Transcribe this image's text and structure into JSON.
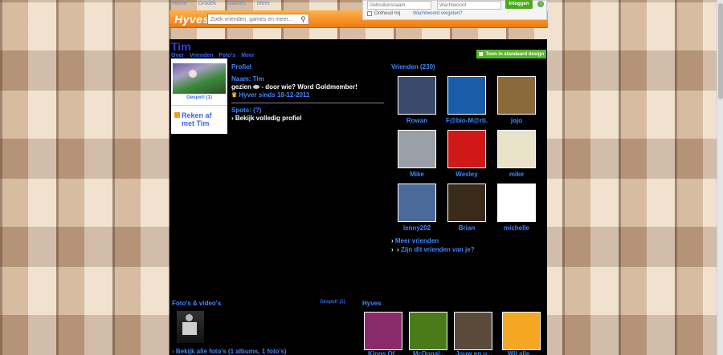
{
  "topnav": [
    "Home",
    "Ontdek",
    "Games",
    "Meer"
  ],
  "header": {
    "logo": "Hyves",
    "search_placeholder": "Zoek vrienden, games en meer..."
  },
  "login": {
    "username_placeholder": "Gebruikersnaam",
    "password_placeholder": "Wachtwoord",
    "button": "Inloggen",
    "remember": "Onthoud mij",
    "forgot": "Wachtwoord vergeten?"
  },
  "profile": {
    "name": "Tim",
    "subnav": [
      "Over",
      "Vrienden",
      "Foto's",
      "Meer"
    ],
    "standard_design_button": "Toon in standaard design",
    "gespot": "Gespot! (1)",
    "reken_af": [
      "Reken af",
      "met Tim"
    ],
    "section_title": "Profiel",
    "name_line": "Naam: Tim",
    "gezien_prefix": "gezien",
    "gezien_suffix": "- door wie? Word Goldmember!",
    "hyver_sinds": "Hyver sinds 18-12-2011",
    "spots": "Spots: (?)",
    "volledig_profiel": "Bekijk volledig profiel"
  },
  "friends": {
    "title": "Vrienden (230)",
    "items": [
      {
        "name": "Rowan",
        "color": "#3b4a6a"
      },
      {
        "name": "F@bio-M@rti...",
        "color": "#1a5ca8"
      },
      {
        "name": "jojo",
        "color": "#8a6a3a"
      },
      {
        "name": "Mike",
        "color": "#9aa0a8"
      },
      {
        "name": "Wesley",
        "color": "#d01818"
      },
      {
        "name": "mike",
        "color": "#e8e2c8"
      },
      {
        "name": "lenny202",
        "color": "#4a6a9a"
      },
      {
        "name": "Brian",
        "color": "#3a2a1a"
      },
      {
        "name": "michelle",
        "color": "#ffffff"
      }
    ],
    "meer": "Meer vrienden",
    "zijn_dit": "Zijn dit vrienden van je?"
  },
  "fotos": {
    "title": "Foto's & video's",
    "gespot": "Gespot! (1)",
    "all": "Bekijk alle foto's (1 albums, 1 foto's)"
  },
  "hyves": {
    "title": "Hyves",
    "items": [
      {
        "name": "Kings Of...",
        "color": "#8a2a6a"
      },
      {
        "name": "McDonal...",
        "color": "#4a7a1a"
      },
      {
        "name": "Jouw en u...",
        "color": "#5a4a3a"
      },
      {
        "name": "Wil alle ...",
        "color": "#f5a623"
      }
    ]
  }
}
